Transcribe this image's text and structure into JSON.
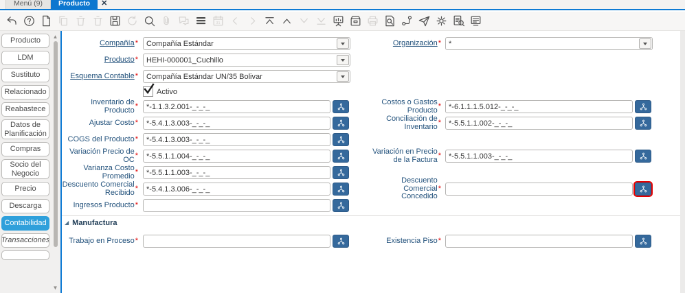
{
  "window": {
    "menu_tab": "Menú (9)",
    "doc_tab": "Producto",
    "close": "✕"
  },
  "toolbar": {
    "items": [
      {
        "name": "undo",
        "enabled": true
      },
      {
        "name": "help",
        "enabled": true
      },
      {
        "name": "new-record",
        "enabled": true
      },
      {
        "name": "copy-record",
        "enabled": false
      },
      {
        "name": "delete-record",
        "enabled": false
      },
      {
        "name": "delete-selection",
        "enabled": false
      },
      {
        "name": "save",
        "enabled": true
      },
      {
        "name": "refresh",
        "enabled": false
      },
      {
        "name": "find",
        "enabled": true
      },
      {
        "name": "attachment",
        "enabled": false
      },
      {
        "name": "chat",
        "enabled": false
      },
      {
        "name": "grid-toggle",
        "enabled": true
      },
      {
        "name": "calendar",
        "enabled": false
      },
      {
        "name": "previous-record",
        "enabled": false
      },
      {
        "name": "next-record",
        "enabled": false
      },
      {
        "name": "first-record",
        "enabled": true
      },
      {
        "name": "parent-record",
        "enabled": true
      },
      {
        "name": "detail-record",
        "enabled": false
      },
      {
        "name": "last-record",
        "enabled": false
      },
      {
        "name": "report",
        "enabled": true
      },
      {
        "name": "archive",
        "enabled": true
      },
      {
        "name": "print",
        "enabled": false
      },
      {
        "name": "print-preview",
        "enabled": true
      },
      {
        "name": "workflow",
        "enabled": true
      },
      {
        "name": "send-mail",
        "enabled": true
      },
      {
        "name": "preferences",
        "enabled": true
      },
      {
        "name": "zoom-across",
        "enabled": true
      },
      {
        "name": "activity-log",
        "enabled": true
      }
    ]
  },
  "sidebar": {
    "tabs": [
      {
        "label": "Producto",
        "selected": false
      },
      {
        "label": "LDM",
        "selected": false
      },
      {
        "label": "Sustituto",
        "selected": false
      },
      {
        "label": "Relacionado",
        "selected": false
      },
      {
        "label": "Reabastece",
        "selected": false
      },
      {
        "label": "Datos de Planificación",
        "selected": false
      },
      {
        "label": "Compras",
        "selected": false
      },
      {
        "label": "Socio del Negocio",
        "selected": false
      },
      {
        "label": "Precio",
        "selected": false
      },
      {
        "label": "Descarga",
        "selected": false
      },
      {
        "label": "Contabilidad",
        "selected": true
      },
      {
        "label": "Transacciones",
        "selected": false,
        "italic": true
      },
      {
        "label": "",
        "selected": false
      }
    ]
  },
  "form": {
    "required_marker": "*",
    "compania": {
      "label": "Compañía",
      "value": "Compañía Estándar"
    },
    "organizacion": {
      "label": "Organización",
      "value": "*"
    },
    "producto": {
      "label": "Producto",
      "value": "HEHI-000001_Cuchillo"
    },
    "esquema": {
      "label": "Esquema Contable",
      "value": "Compañía Estándar UN/35 Bolivar"
    },
    "activo": {
      "label": "Activo",
      "checked": true
    },
    "inventario": {
      "label": "Inventario de Producto",
      "value": "*-1.1.3.2.001-_-_-_"
    },
    "costos": {
      "label": "Costos o Gastos Producto",
      "value": "*-6.1.1.1.5.012-_-_-_"
    },
    "ajustar": {
      "label": "Ajustar Costo",
      "value": "*-5.4.1.3.003-_-_-_"
    },
    "conciliacion": {
      "label": "Conciliación de Inventario",
      "value": "*-5.5.1.1.002-_-_-_"
    },
    "cogs": {
      "label": "COGS del Producto",
      "value": "*-5.4.1.3.003-_-_-_"
    },
    "var_oc": {
      "label": "Variación Precio de OC",
      "value": "*-5.5.1.1.004-_-_-_"
    },
    "var_factura": {
      "label": "Variación en Precio de la Factura",
      "value": "*-5.5.1.1.003-_-_-_"
    },
    "varianza": {
      "label": "Varianza Costo Promedio",
      "value": "*-5.5.1.1.003-_-_-_"
    },
    "desc_recibido": {
      "label": "Descuento Comercial Recibido",
      "value": "*-5.4.1.3.006-_-_-_"
    },
    "desc_concedido": {
      "label": "Descuento Comercial Concedido",
      "value": "",
      "highlighted": true
    },
    "ingresos": {
      "label": "Ingresos Producto",
      "value": ""
    },
    "manufactura": {
      "title": "Manufactura"
    },
    "trabajo": {
      "label": "Trabajo en Proceso",
      "value": ""
    },
    "existencia": {
      "label": "Existencia Piso",
      "value": ""
    }
  },
  "icons": {
    "group_expand": "◢",
    "scroll_up": "▲",
    "scroll_down": "▼"
  },
  "colors": {
    "accent": "#0d7ad4",
    "active_tab": "#0c77cf",
    "sidebar_selected_tab": "#2fa0db",
    "account_button": "#35699c",
    "required": "#e00000",
    "highlight_border": "#e60000"
  }
}
